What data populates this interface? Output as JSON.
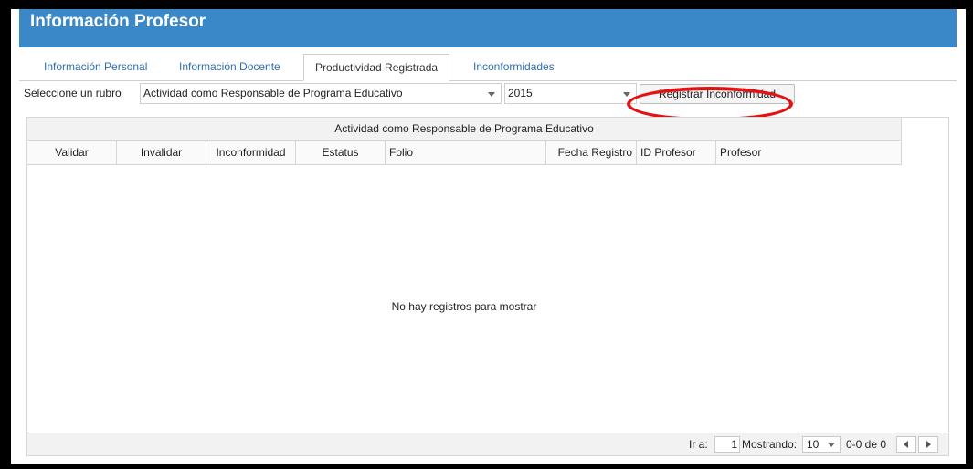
{
  "window": {
    "title": "Información Profesor"
  },
  "tabs": [
    {
      "label": "Información Personal"
    },
    {
      "label": "Información Docente"
    },
    {
      "label": "Productividad Registrada",
      "active": true
    },
    {
      "label": "Inconformidades"
    }
  ],
  "toolbar": {
    "rubro_label": "Seleccione un rubro",
    "rubro_value": "Actividad como Responsable de Programa Educativo",
    "year_value": "2015",
    "register_button": "Registrar Inconformidad"
  },
  "grid": {
    "caption": "Actividad como Responsable de Programa Educativo",
    "columns": [
      "Validar",
      "Invalidar",
      "Inconformidad",
      "Estatus",
      "Folio",
      "Fecha Registro",
      "ID Profesor",
      "Profesor"
    ],
    "empty_message": "No hay registros para mostrar"
  },
  "pager": {
    "goto_label": "Ir a:",
    "page_value": "1",
    "showing_label": "Mostrando:",
    "page_size": "10",
    "range_text": "0-0 de 0"
  },
  "colors": {
    "title_bar": "#3b88c8",
    "highlight_circle": "#e41313",
    "tab_link": "#2e6fae"
  },
  "icons": {
    "dropdown": "chevron-down-icon",
    "prev": "arrow-left-icon",
    "next": "arrow-right-icon"
  }
}
